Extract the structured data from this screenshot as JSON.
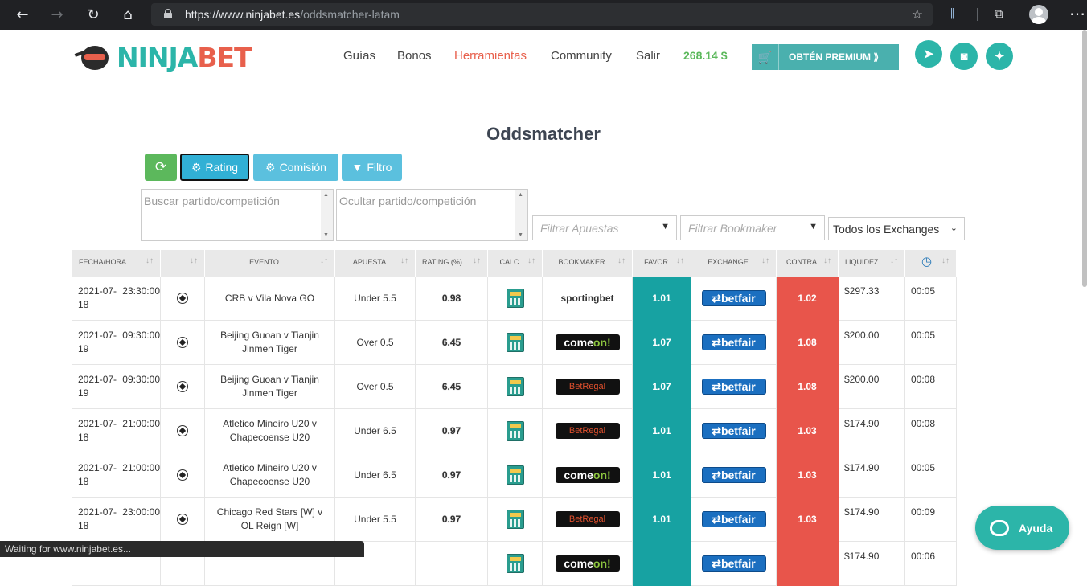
{
  "browser": {
    "url_prefix": "https://www.",
    "url_host": "ninjabet.es",
    "url_path": "/oddsmatcher-latam",
    "status_text": "Waiting for www.ninjabet.es..."
  },
  "site": {
    "logo_part1": "NINJA",
    "logo_part2": "BET",
    "nav": [
      "Guías",
      "Bonos",
      "Herramientas",
      "Community",
      "Salir"
    ],
    "balance": "268.14 $",
    "premium_label": "OBTÉN PREMIUM ⟫",
    "colors": {
      "brand_teal": "#2cb5a9",
      "brand_red": "#e8604c",
      "favor": "#17a2a2",
      "contra": "#e8554b"
    }
  },
  "page": {
    "title": "Oddsmatcher",
    "buttons": {
      "rating": "Rating",
      "comision": "Comisión",
      "filtro": "Filtro"
    },
    "search_placeholder": "Buscar partido/competición",
    "hide_placeholder": "Ocultar partido/competición",
    "filter_bets": "Filtrar Apuestas",
    "filter_bookmaker": "Filtrar Bookmaker",
    "exchange_select": "Todos los Exchanges",
    "help_label": "Ayuda"
  },
  "table": {
    "headers": [
      "FECHA/HORA",
      "",
      "EVENTO",
      "APUESTA",
      "RATING (%)",
      "CALC",
      "BOOKMAKER",
      "FAVOR",
      "EXCHANGE",
      "CONTRA",
      "LIQUIDEZ",
      ""
    ],
    "rows": [
      {
        "date": "2021-07-18",
        "time": "23:30:00",
        "event": "CRB v Vila Nova GO",
        "bet": "Under 5.5",
        "rating": "0.98",
        "bookmaker": "sportingbet",
        "favor": "1.01",
        "exchange": "betfair",
        "contra": "1.02",
        "liquidity": "$297.33",
        "age": "00:05"
      },
      {
        "date": "2021-07-19",
        "time": "09:30:00",
        "event": "Beijing Guoan v Tianjin Jinmen Tiger",
        "bet": "Over 0.5",
        "rating": "6.45",
        "bookmaker": "comeon",
        "favor": "1.07",
        "exchange": "betfair",
        "contra": "1.08",
        "liquidity": "$200.00",
        "age": "00:05"
      },
      {
        "date": "2021-07-19",
        "time": "09:30:00",
        "event": "Beijing Guoan v Tianjin Jinmen Tiger",
        "bet": "Over 0.5",
        "rating": "6.45",
        "bookmaker": "betregal",
        "favor": "1.07",
        "exchange": "betfair",
        "contra": "1.08",
        "liquidity": "$200.00",
        "age": "00:08"
      },
      {
        "date": "2021-07-18",
        "time": "21:00:00",
        "event": "Atletico Mineiro U20 v Chapecoense U20",
        "bet": "Under 6.5",
        "rating": "0.97",
        "bookmaker": "betregal",
        "favor": "1.01",
        "exchange": "betfair",
        "contra": "1.03",
        "liquidity": "$174.90",
        "age": "00:08"
      },
      {
        "date": "2021-07-18",
        "time": "21:00:00",
        "event": "Atletico Mineiro U20 v Chapecoense U20",
        "bet": "Under 6.5",
        "rating": "0.97",
        "bookmaker": "comeon",
        "favor": "1.01",
        "exchange": "betfair",
        "contra": "1.03",
        "liquidity": "$174.90",
        "age": "00:05"
      },
      {
        "date": "2021-07-18",
        "time": "23:00:00",
        "event": "Chicago Red Stars [W] v OL Reign [W]",
        "bet": "Under 5.5",
        "rating": "0.97",
        "bookmaker": "betregal",
        "favor": "1.01",
        "exchange": "betfair",
        "contra": "1.03",
        "liquidity": "$174.90",
        "age": "00:09"
      },
      {
        "date": "",
        "time": "",
        "event": "",
        "bet": "",
        "rating": "",
        "bookmaker": "comeon",
        "favor": "",
        "exchange": "betfair",
        "contra": "",
        "liquidity": "$174.90",
        "age": "00:06"
      }
    ]
  },
  "bookmaker_labels": {
    "sportingbet": "sportingbet",
    "comeon_a": "come",
    "comeon_b": "on!",
    "betregal": "BetRegal",
    "betfair": "⇄betfair"
  }
}
